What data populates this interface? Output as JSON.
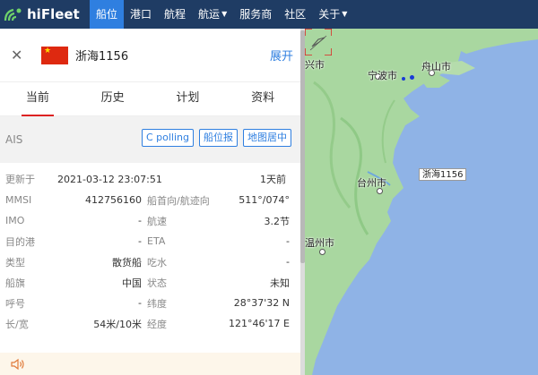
{
  "brand": {
    "name": "hiFleet"
  },
  "nav": [
    {
      "label": "船位",
      "active": true,
      "dropdown": false
    },
    {
      "label": "港口",
      "active": false,
      "dropdown": false
    },
    {
      "label": "航程",
      "active": false,
      "dropdown": false
    },
    {
      "label": "航运",
      "active": false,
      "dropdown": true
    },
    {
      "label": "服务商",
      "active": false,
      "dropdown": false
    },
    {
      "label": "社区",
      "active": false,
      "dropdown": false
    },
    {
      "label": "关于",
      "active": false,
      "dropdown": true
    }
  ],
  "panel": {
    "ship_name": "浙海1156",
    "expand_label": "展开",
    "tabs": [
      "当前",
      "历史",
      "计划",
      "资料"
    ],
    "ais_label": "AIS",
    "buttons": {
      "c_polling": "C polling",
      "position_report": "船位报",
      "map_center": "地图居中"
    },
    "updated": {
      "label": "更新于",
      "time": "2021-03-12 23:07:51",
      "ago": "1天前"
    },
    "rows": [
      {
        "k1": "MMSI",
        "v1": "412756160",
        "k2": "船首向/航迹向",
        "v2": "511°/074°"
      },
      {
        "k1": "IMO",
        "v1": "-",
        "k2": "航速",
        "v2": "3.2节"
      },
      {
        "k1": "目的港",
        "v1": "-",
        "k2": "ETA",
        "v2": "-"
      },
      {
        "k1": "类型",
        "v1": "散货船",
        "k2": "吃水",
        "v2": "-"
      },
      {
        "k1": "船旗",
        "v1": "中国",
        "k2": "状态",
        "v2": "未知"
      },
      {
        "k1": "呼号",
        "v1": "-",
        "k2": "纬度",
        "v2": "28°37'32 N"
      },
      {
        "k1": "长/宽",
        "v1": "54米/10米",
        "k2": "经度",
        "v2": "121°46'17 E"
      }
    ]
  },
  "map": {
    "cities": [
      "兴市",
      "宁波市",
      "舟山市",
      "台州市",
      "温州市"
    ],
    "ship_label": "浙海1156"
  },
  "colors": {
    "nav_bg": "#1f3c64",
    "nav_active": "#2f7fe0",
    "accent": "#2f7fe0",
    "sea": "#8fb3e6",
    "land": "#a9d7a0",
    "tab_underline": "#dd2222"
  },
  "icons": [
    "logo-icon",
    "close-icon",
    "china-flag-icon",
    "caret-down-icon",
    "speaker-icon",
    "ship-target-icon"
  ]
}
